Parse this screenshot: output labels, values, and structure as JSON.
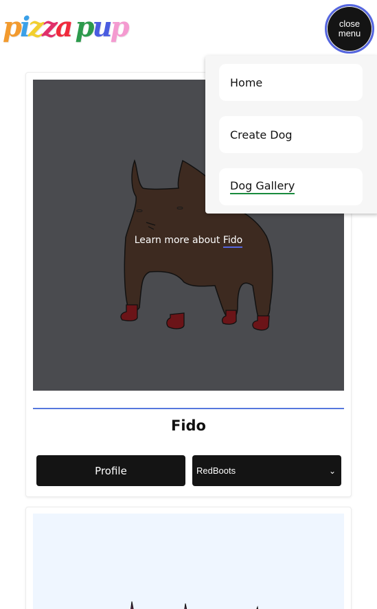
{
  "header": {
    "logo_letters": [
      {
        "char": "p",
        "color": "#f29a2e"
      },
      {
        "char": "i",
        "color": "#3aa0e8"
      },
      {
        "char": "z",
        "color": "#f2cf2e"
      },
      {
        "char": "z",
        "color": "#e0306a"
      },
      {
        "char": "a",
        "color": "#f02a3c"
      },
      {
        "char": "p",
        "color": "#2d9a4c"
      },
      {
        "char": "u",
        "color": "#4a5ce0"
      },
      {
        "char": "p",
        "color": "#f49ad0"
      }
    ],
    "close_label_line1": "close",
    "close_label_line2": "menu"
  },
  "menu": {
    "items": [
      {
        "label": "Home"
      },
      {
        "label": "Create Dog"
      },
      {
        "label": "Dog Gallery",
        "active": true
      }
    ]
  },
  "cards": [
    {
      "overlay_prefix": "Learn more about ",
      "overlay_link": "Fido",
      "name": "Fido",
      "profile_label": "Profile",
      "select_value": "RedBoots"
    }
  ],
  "colors": {
    "accent": "#5566e0",
    "active_underline": "#188a3c",
    "image_bg": "#4a4b4f",
    "dog_body": "#3d2a20",
    "boots": "#6b1418"
  }
}
